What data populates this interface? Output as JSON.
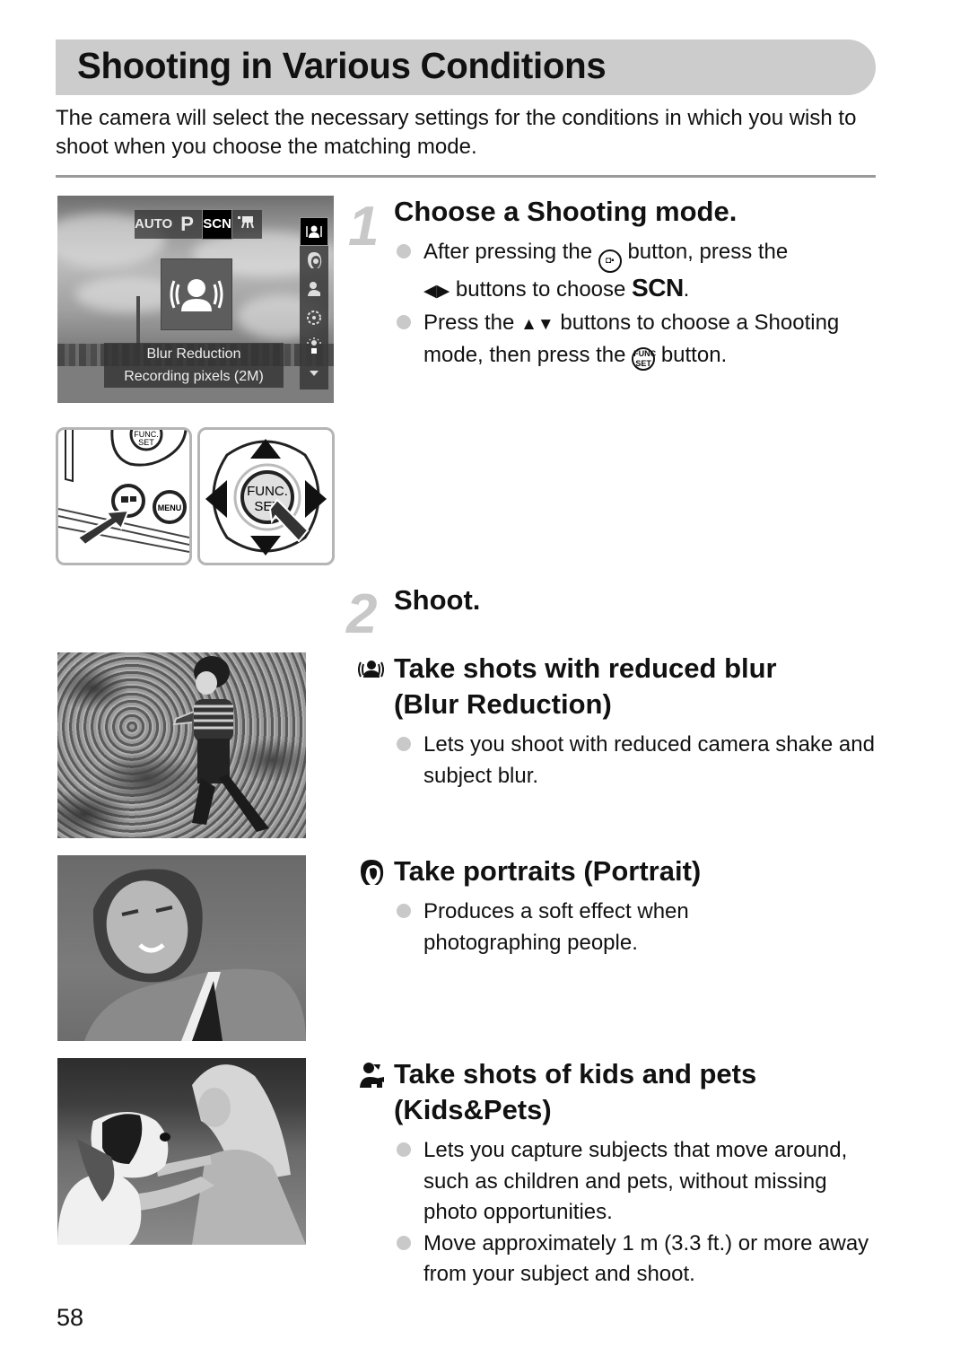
{
  "header": {
    "title": "Shooting in Various Conditions",
    "intro": "The camera will select the necessary settings for the conditions in which you wish to shoot when you choose the matching mode."
  },
  "lcd_screen": {
    "modes": [
      "AUTO",
      "P",
      "SCN",
      "movie"
    ],
    "selected_mode": "SCN",
    "scene_icons": [
      "blur-reduction-icon",
      "portrait-icon",
      "kids-pets-icon",
      "smart-shutter-icon",
      "low-light-icon"
    ],
    "selected_scene": "blur-reduction-icon",
    "caption_line1": "Blur Reduction",
    "caption_line2": "Recording pixels (2M)"
  },
  "illustrations": {
    "left": {
      "labels": [
        "FUNC. SET",
        "MENU"
      ]
    },
    "right": {
      "label_line1": "FUNC.",
      "label_line2": "SET"
    }
  },
  "step1": {
    "number": "1",
    "title": "Choose a Shooting mode.",
    "bullet1_part1": "After pressing the",
    "bullet1_part2": "button, press the",
    "bullet1_part3": "buttons to choose",
    "bullet1_scn": "SCN",
    "bullet1_end": ".",
    "bullet2_part1": "Press the",
    "bullet2_part2": "buttons to choose a Shooting mode, then press the",
    "bullet2_part3": "button.",
    "func_set_top": "FUNC",
    "func_set_bottom": "SET"
  },
  "step2": {
    "number": "2",
    "title": "Shoot."
  },
  "sections": [
    {
      "icon": "blur-reduction-icon",
      "title_line1": "Take shots with reduced blur",
      "title_line2": "(Blur Reduction)",
      "bullets": [
        "Lets you shoot with reduced camera shake and subject blur."
      ]
    },
    {
      "icon": "portrait-icon",
      "title_line1": "Take portraits (Portrait)",
      "bullets": [
        "Produces a soft effect when photographing people."
      ]
    },
    {
      "icon": "kids-pets-icon",
      "title_line1": "Take shots of kids and pets",
      "title_line2": "(Kids&Pets)",
      "bullets": [
        "Lets you capture subjects that move around, such as children and pets, without missing photo opportunities.",
        "Move approximately 1 m (3.3 ft.) or more away from your subject and shoot."
      ]
    }
  ],
  "photos": [
    "running-child-photo",
    "smiling-woman-photo",
    "girl-with-dog-photo"
  ],
  "footer": {
    "page_number": "58"
  }
}
